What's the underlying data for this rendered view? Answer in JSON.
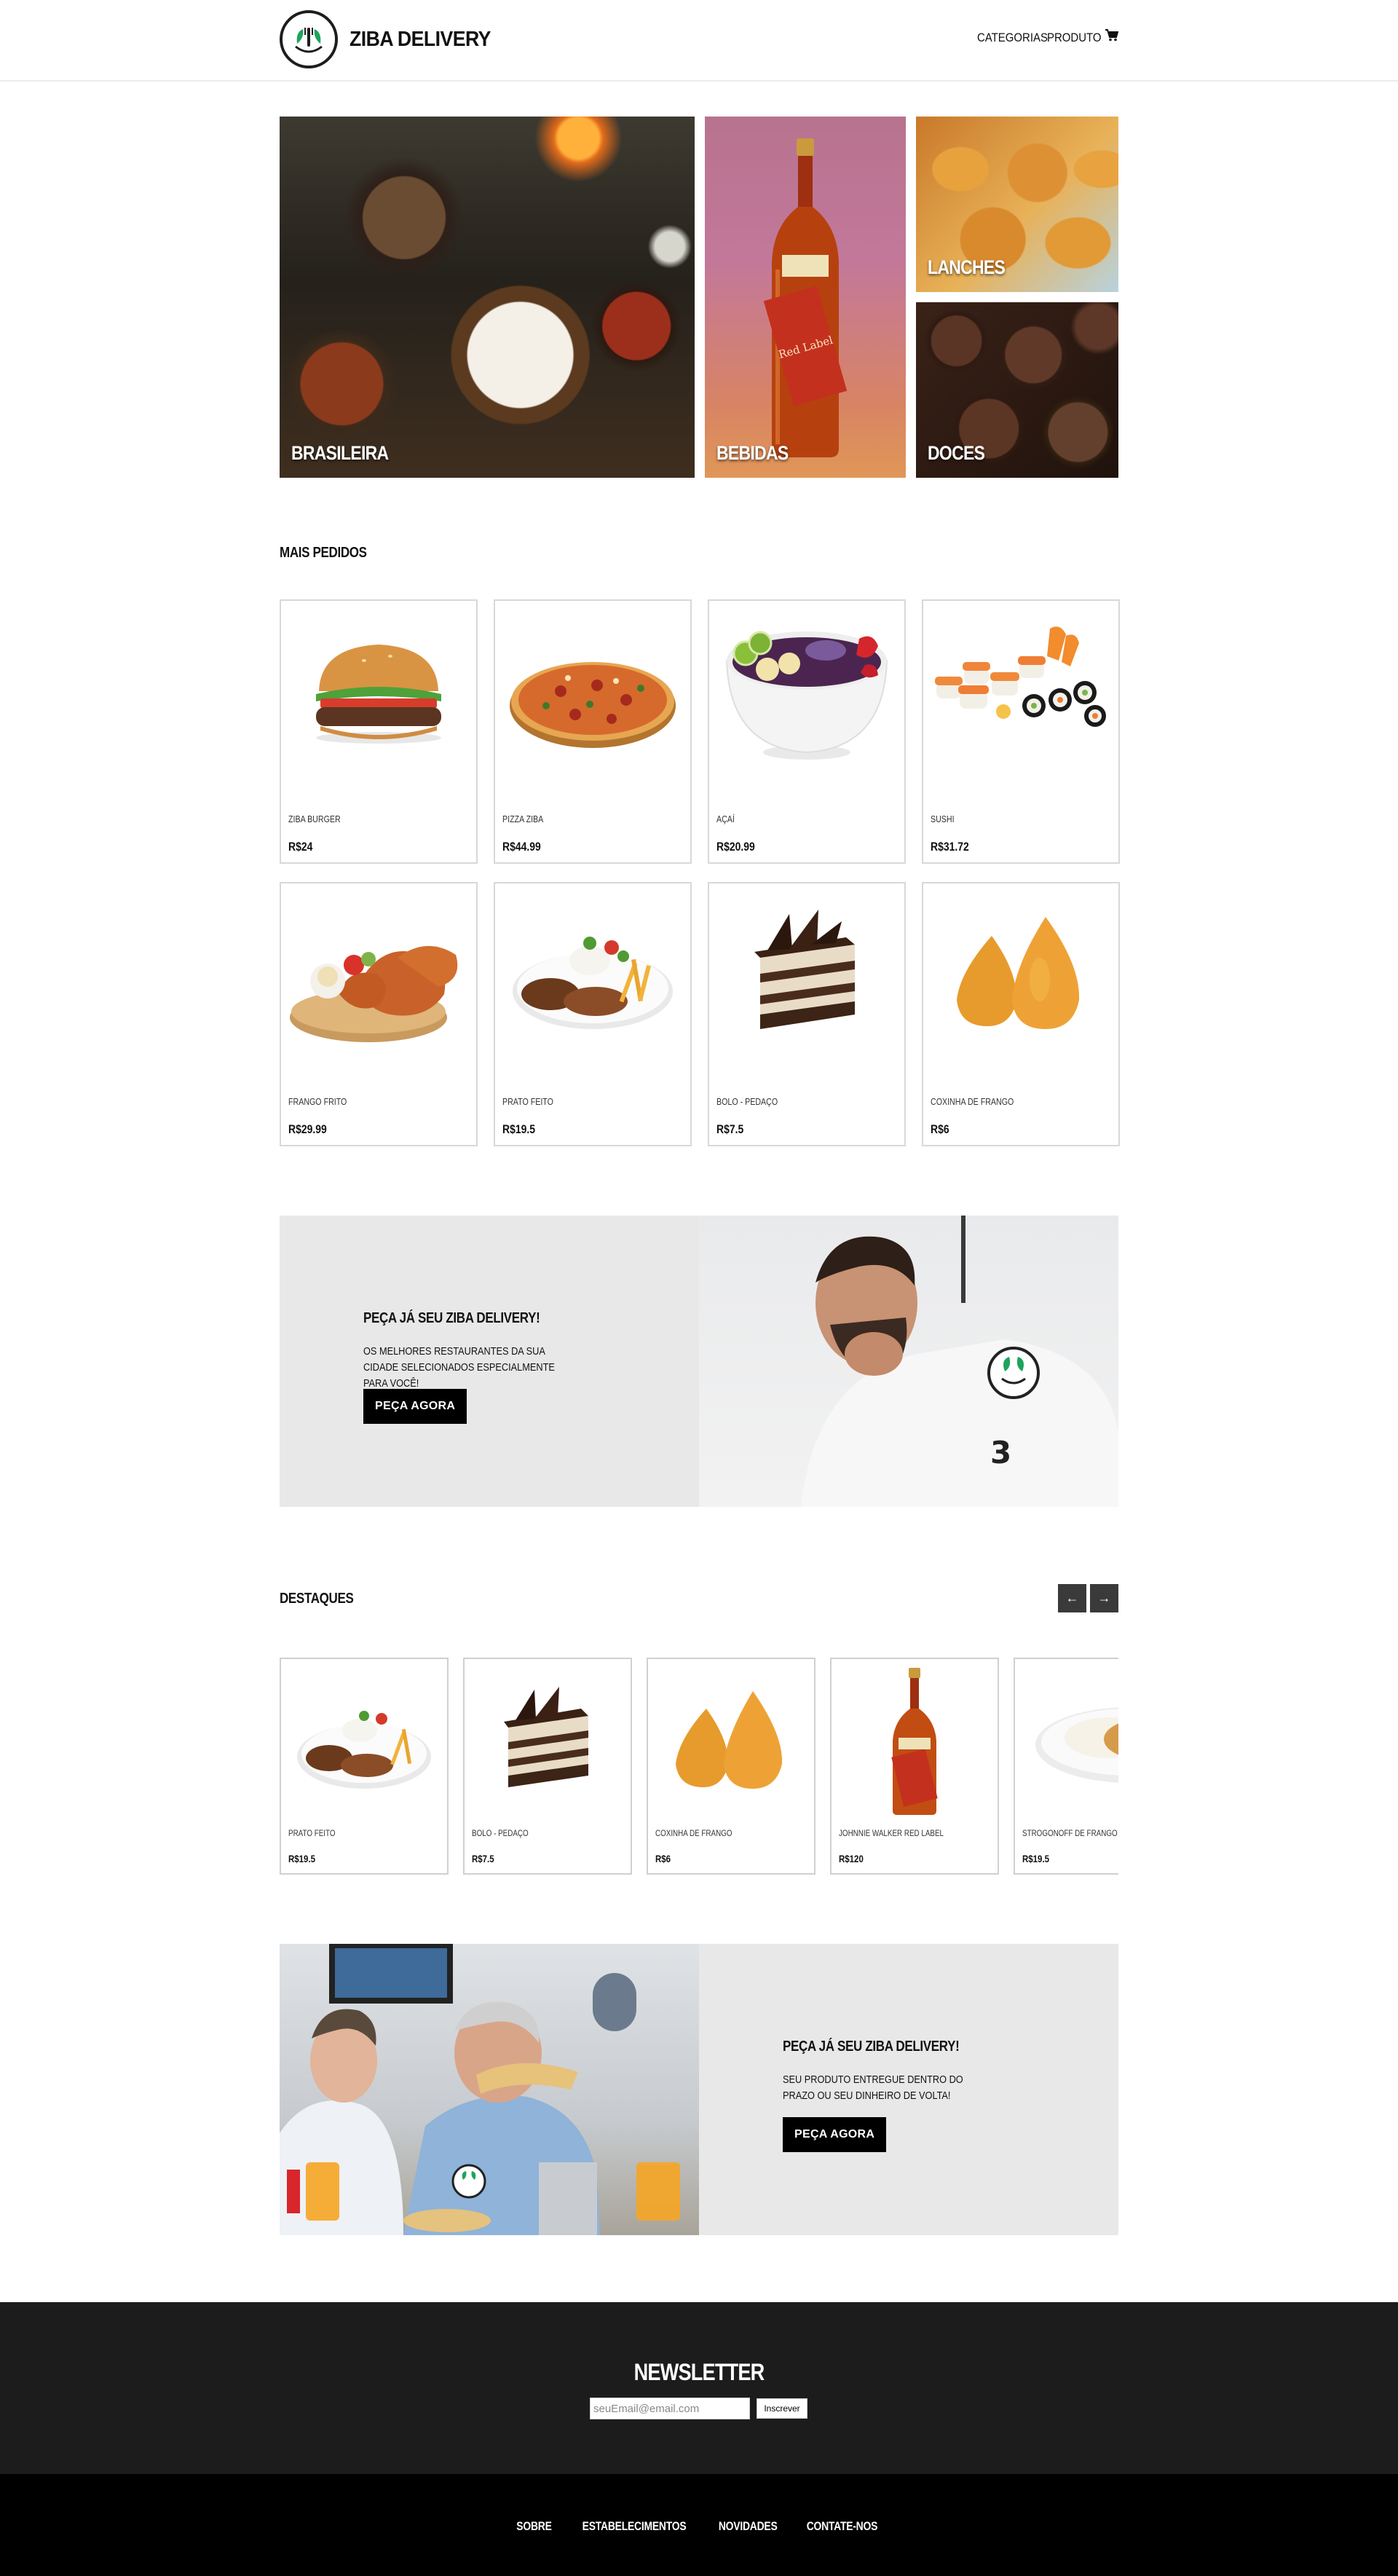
{
  "header": {
    "brand": "ZIBA DELIVERY",
    "nav": {
      "categorias": "CATEGORIAS",
      "produto": "PRODUTO"
    },
    "icons": {
      "logo": "leaf-fork-icon",
      "cart": "cart-icon"
    }
  },
  "categories": {
    "brasileira": "BRASILEIRA",
    "bebidas": "BEBIDAS",
    "lanches": "LANCHES",
    "doces": "DOCES",
    "bottle_label": "Red Label"
  },
  "mais_pedidos": {
    "title": "MAIS PEDIDOS",
    "items": [
      {
        "name": "ZIBA BURGER",
        "price": "R$24"
      },
      {
        "name": "PIZZA ZIBA",
        "price": "R$44.99"
      },
      {
        "name": "AÇAÍ",
        "price": "R$20.99"
      },
      {
        "name": "SUSHI",
        "price": "R$31.72"
      },
      {
        "name": "FRANGO FRITO",
        "price": "R$29.99"
      },
      {
        "name": "PRATO FEITO",
        "price": "R$19.5"
      },
      {
        "name": "BOLO - PEDAÇO",
        "price": "R$7.5"
      },
      {
        "name": "COXINHA DE FRANGO",
        "price": "R$6"
      }
    ]
  },
  "promo1": {
    "title": "PEÇA JÁ SEU ZIBA DELIVERY!",
    "text": "OS MELHORES RESTAURANTES DA SUA CIDADE SELECIONADOS ESPECIALMENTE PARA VOCÊ!",
    "button": "PEÇA AGORA"
  },
  "destaques": {
    "title": "DESTAQUES",
    "prev": "←",
    "next": "→",
    "items": [
      {
        "name": "PRATO FEITO",
        "price": "R$19.5"
      },
      {
        "name": "BOLO - PEDAÇO",
        "price": "R$7.5"
      },
      {
        "name": "COXINHA DE FRANGO",
        "price": "R$6"
      },
      {
        "name": "JOHNNIE WALKER RED LABEL",
        "price": "R$120"
      },
      {
        "name": "STROGONOFF DE FRANGO",
        "price": "R$19.5"
      }
    ]
  },
  "promo2": {
    "title": "PEÇA JÁ SEU ZIBA DELIVERY!",
    "text": "SEU PRODUTO ENTREGUE DENTRO DO PRAZO OU SEU DINHEIRO DE VOLTA!",
    "button": "PEÇA AGORA"
  },
  "newsletter": {
    "title": "NEWSLETTER",
    "placeholder": "seuEmail@email.com",
    "button": "Inscrever"
  },
  "footer": {
    "links": [
      "SOBRE",
      "ESTABELECIMENTOS",
      "NOVIDADES",
      "CONTATE-NOS"
    ]
  },
  "colors": {
    "accent": "#000000",
    "panel": "#e8e8e8",
    "newsletter_bg": "#1c1c1c",
    "footer_bg": "#000000",
    "logo_green": "#1fa35c"
  }
}
